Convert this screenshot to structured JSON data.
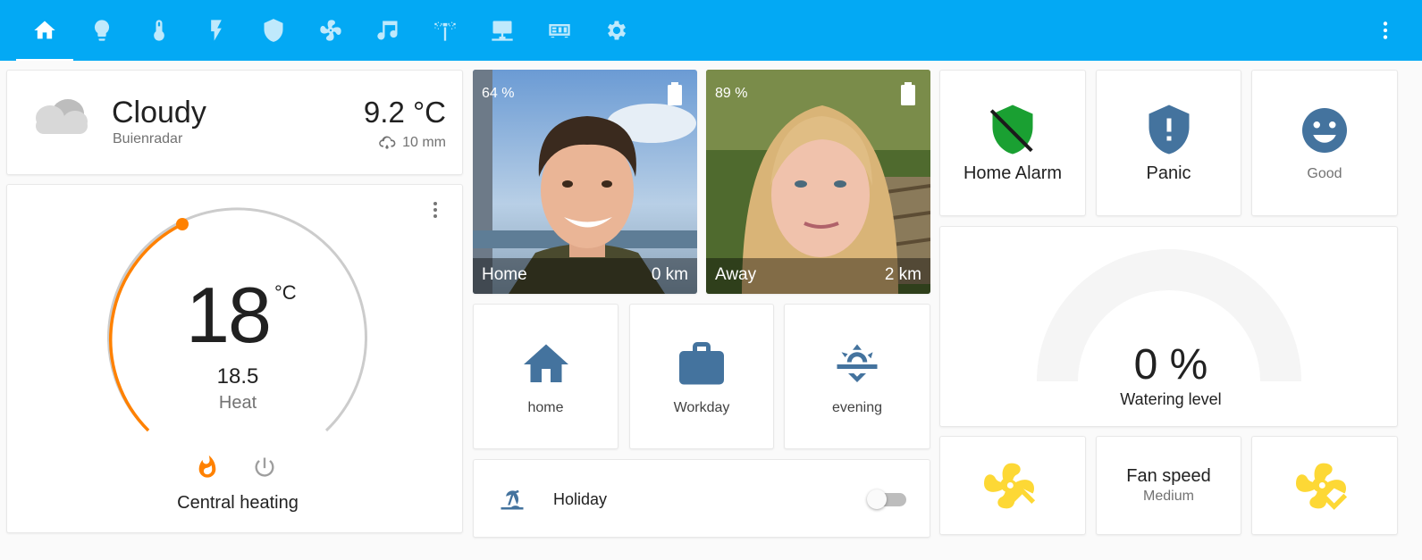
{
  "header": {
    "tabs": [
      {
        "icon": "home-icon",
        "active": true
      },
      {
        "icon": "lightbulb-icon"
      },
      {
        "icon": "thermometer-icon"
      },
      {
        "icon": "flash-icon"
      },
      {
        "icon": "shield-icon"
      },
      {
        "icon": "fan-icon"
      },
      {
        "icon": "music-note-icon"
      },
      {
        "icon": "sprinkler-icon"
      },
      {
        "icon": "network-icon"
      },
      {
        "icon": "receiver-icon"
      },
      {
        "icon": "gear-icon"
      }
    ],
    "menu_icon": "dots-vertical-icon",
    "accent_color": "#03a9f4"
  },
  "weather": {
    "condition": "Cloudy",
    "source": "Buienradar",
    "temperature": "9.2 °C",
    "precipitation": "10 mm"
  },
  "thermostat": {
    "target": "18",
    "unit": "°C",
    "current": "18.5",
    "mode": "Heat",
    "name": "Central heating",
    "arc_color": "#ff8100"
  },
  "persons": [
    {
      "battery": "64 %",
      "state": "Home",
      "distance": "0 km"
    },
    {
      "battery": "89 %",
      "state": "Away",
      "distance": "2 km"
    }
  ],
  "mode_buttons": [
    {
      "label": "home",
      "icon": "home-icon"
    },
    {
      "label": "Workday",
      "icon": "briefcase-icon"
    },
    {
      "label": "evening",
      "icon": "sunset-icon"
    }
  ],
  "holiday": {
    "label": "Holiday",
    "icon": "beach-icon",
    "on": false
  },
  "status_buttons": [
    {
      "label": "Home Alarm",
      "icon": "shield-off-icon",
      "color": "#1aa032"
    },
    {
      "label": "Panic",
      "icon": "shield-alert-icon",
      "color": "#44739e"
    },
    {
      "label": "Good",
      "icon": "emoticon-happy-icon",
      "color": "#44739e"
    }
  ],
  "watering": {
    "value": "0 %",
    "label": "Watering level"
  },
  "fan": {
    "title": "Fan speed",
    "value": "Medium",
    "up_icon": "fan-chevron-up-icon",
    "down_icon": "fan-chevron-down-icon",
    "color": "#fdd835"
  }
}
